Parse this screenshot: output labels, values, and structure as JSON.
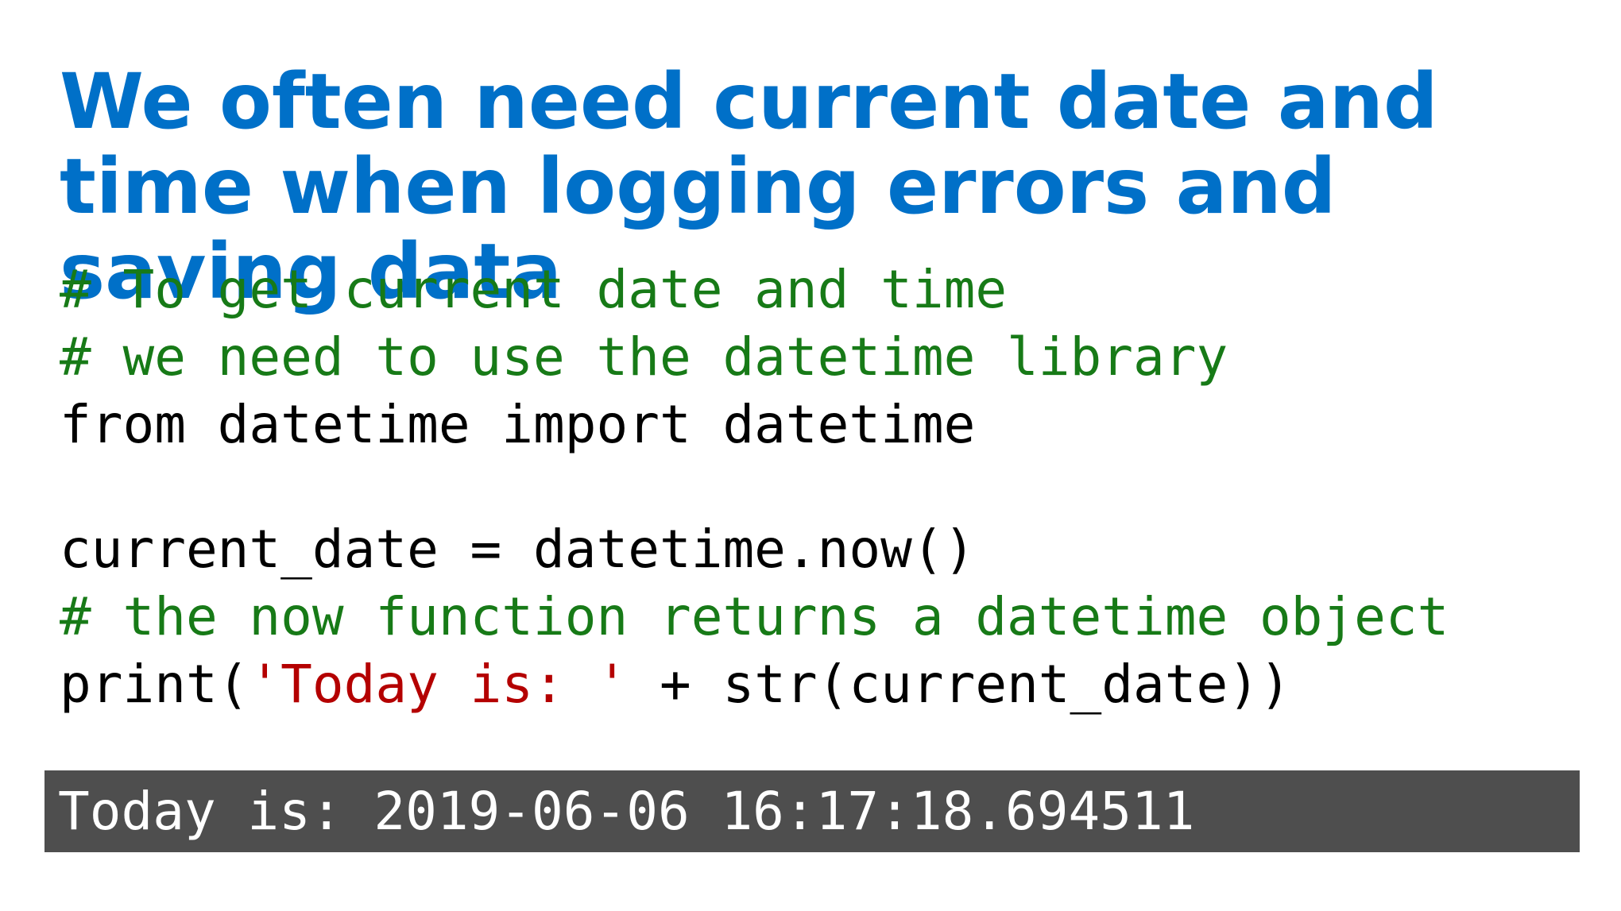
{
  "slide": {
    "title": "We often need current date and time when logging errors and saving data"
  },
  "code": {
    "line1": "# To get current date and time",
    "line2": "# we need to use the datetime library",
    "line3": "from datetime import datetime",
    "line5": "current_date = datetime.now()",
    "line6": "# the now function returns a datetime object",
    "line7_before": "print(",
    "line7_string": "'Today is: '",
    "line7_after": " + str(current_date))"
  },
  "output": {
    "text": "Today is: 2019-06-06 16:17:18.694511"
  },
  "colors": {
    "title": "#0070c8",
    "comment": "#177a17",
    "string": "#b40000",
    "output_background": "#4e4e4e",
    "output_text": "#ffffff"
  }
}
